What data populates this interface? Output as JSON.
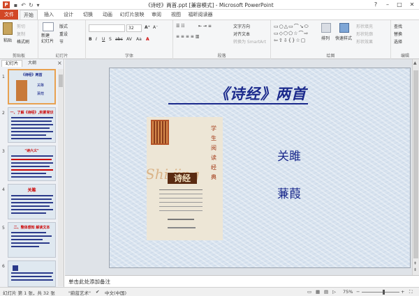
{
  "window": {
    "title": "《诗经》两首.ppt [兼容模式] - Microsoft PowerPoint",
    "app_icon": "P"
  },
  "tabs": [
    "文件",
    "开始",
    "插入",
    "设计",
    "切换",
    "动画",
    "幻灯片放映",
    "审阅",
    "视图",
    "福昕阅读器"
  ],
  "ribbon": {
    "clipboard": {
      "paste": "粘贴",
      "cut": "剪切",
      "copy": "复制",
      "format_painter": "格式刷",
      "label": "剪贴板"
    },
    "slides": {
      "new_slide": "新建\n幻灯片",
      "layout": "版式",
      "reset": "重设",
      "section": "节",
      "label": "幻灯片"
    },
    "font": {
      "font_name": "",
      "font_size": "32",
      "label": "字体",
      "format_buttons": [
        "B",
        "I",
        "U",
        "S",
        "abc",
        "AV",
        "Aa",
        "A"
      ]
    },
    "paragraph": {
      "text_direction": "文字方向",
      "align_text": "对齐文本",
      "smartart": "转换为 SmartArt",
      "label": "段落"
    },
    "drawing": {
      "arrange": "排列",
      "quick_styles": "快速样式",
      "shape_fill": "形状填充",
      "shape_outline": "形状轮廓",
      "shape_effects": "形状效果",
      "label": "绘图"
    },
    "editing": {
      "find": "查找",
      "replace": "替换",
      "select": "选择",
      "label": "编辑"
    }
  },
  "panel": {
    "tab_slides": "幻灯片",
    "tab_outline": "大纲",
    "thumbs": [
      {
        "num": "1",
        "title": "《诗经》两首"
      },
      {
        "num": "2",
        "title": "一、了解《诗经》,积累常识"
      },
      {
        "num": "3",
        "title": "\"诗六义\""
      },
      {
        "num": "4",
        "title": "关雎"
      },
      {
        "num": "5",
        "title": "二、整体感知 解读文本"
      },
      {
        "num": "6",
        "title": ""
      }
    ]
  },
  "slide": {
    "title": "《诗经》两首",
    "poems": [
      "关雎",
      "蒹葭"
    ],
    "book": {
      "cover_title": "诗经",
      "vertical_text": "学生阅读经典",
      "watermark": "Shi jing"
    }
  },
  "notes": {
    "placeholder": "单击此处添加备注"
  },
  "status": {
    "slide_info": "幻灯片 第 1 张，共 32 张",
    "theme": "\"蔚蓝艺术\"",
    "language": "中文(中国)",
    "zoom": "75%"
  },
  "colors": {
    "accent": "#d24726",
    "title_blue": "#1b2a8c",
    "selection": "#e8a150"
  }
}
